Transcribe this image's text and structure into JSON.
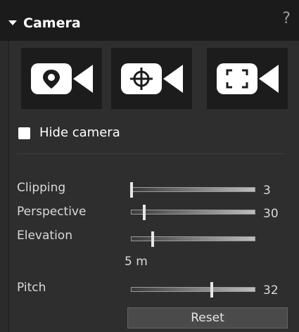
{
  "header": {
    "title": "Camera",
    "help": "?"
  },
  "camera_buttons": [
    {
      "icon": "camera-location-icon"
    },
    {
      "icon": "camera-target-icon"
    },
    {
      "icon": "camera-frame-icon"
    }
  ],
  "hide_camera": {
    "label": "Hide camera",
    "checked": false
  },
  "sliders": {
    "clipping": {
      "label": "Clipping",
      "value": "3",
      "position": 0.0
    },
    "perspective": {
      "label": "Perspective",
      "value": "30",
      "position": 0.1
    },
    "elevation": {
      "label": "Elevation",
      "value": "5 m",
      "position": 0.17
    },
    "pitch": {
      "label": "Pitch",
      "value": "32",
      "position": 0.65
    }
  },
  "reset_label": "Reset"
}
